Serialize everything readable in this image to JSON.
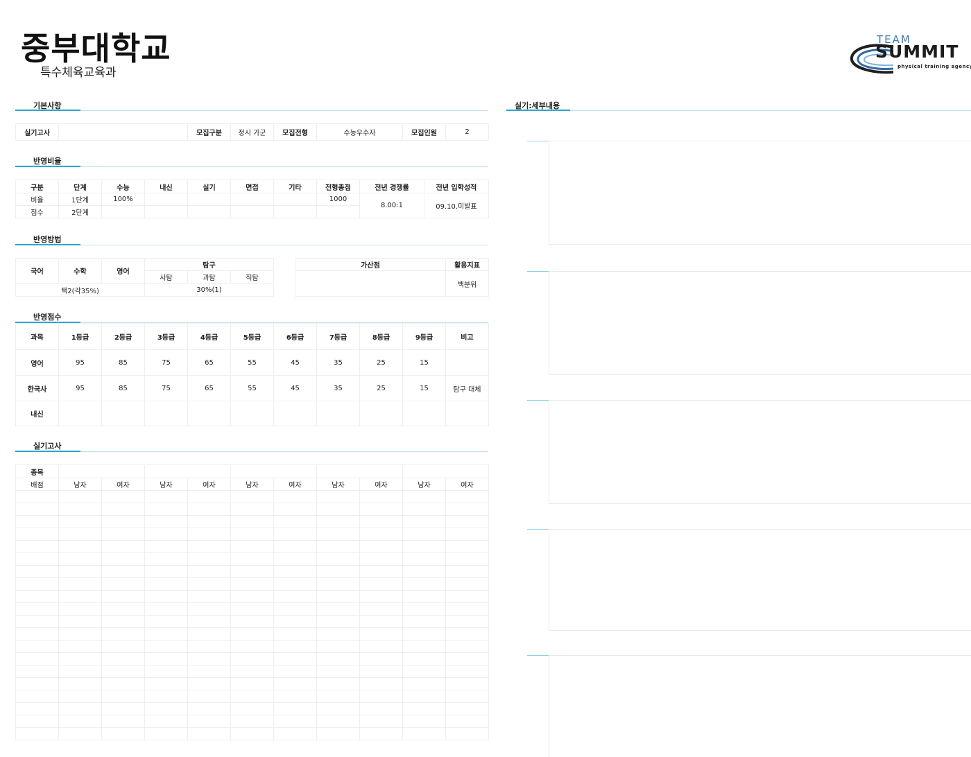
{
  "header": {
    "title": "중부대학교",
    "subtitle": "특수체육교육과"
  },
  "logo": {
    "team": "TEAM",
    "summit": "SUMMIT",
    "tagline": "physical training agency"
  },
  "sections": {
    "basic": "기본사항",
    "ratio": "반영비율",
    "method": "반영방법",
    "score": "반영점수",
    "practical": "실기고사",
    "detail": "실기:세부내용"
  },
  "basic_info": {
    "exam_label": "실기고사",
    "exam_value": "",
    "type_label": "모집구분",
    "type_value": "정시 가군",
    "process_label": "모집전형",
    "process_value": "수능우수자",
    "quota_label": "모집인원",
    "quota_value": "2"
  },
  "ratio_table": {
    "headers": [
      "구분",
      "단계",
      "수능",
      "내신",
      "실기",
      "면접",
      "기타",
      "전형총점",
      "전년 경쟁률",
      "전년 입학성적"
    ],
    "row1": [
      "비율",
      "1단계",
      "100%",
      "",
      "",
      "",
      "",
      "1000"
    ],
    "row2": [
      "점수",
      "2단계",
      "",
      "",
      "",
      "",
      "",
      ""
    ],
    "competition": "8.00:1",
    "admission": "09.10.미발표"
  },
  "method_table": {
    "korean": "국어",
    "math": "수학",
    "english": "영어",
    "inquiry": "탐구",
    "social": "사탐",
    "science": "과탐",
    "vocational": "직탐",
    "core_value": "택2(각35%)",
    "inquiry_value": "30%(1)",
    "bonus_label": "가산점",
    "bonus_value": "",
    "index_label": "활용지표",
    "index_value": "백분위"
  },
  "score_table": {
    "headers": [
      "과목",
      "1등급",
      "2등급",
      "3등급",
      "4등급",
      "5등급",
      "6등급",
      "7등급",
      "8등급",
      "9등급",
      "비고"
    ],
    "rows": [
      {
        "subject": "영어",
        "values": [
          "95",
          "85",
          "75",
          "65",
          "55",
          "45",
          "35",
          "25",
          "15"
        ],
        "note": ""
      },
      {
        "subject": "한국사",
        "values": [
          "95",
          "85",
          "75",
          "65",
          "55",
          "45",
          "35",
          "25",
          "15"
        ],
        "note": "탐구 대체"
      },
      {
        "subject": "내신",
        "values": [
          "",
          "",
          "",
          "",
          "",
          "",
          "",
          "",
          ""
        ],
        "note": ""
      }
    ]
  },
  "practical_table": {
    "event_label": "종목",
    "score_label": "배점",
    "genders": [
      "남자",
      "여자",
      "남자",
      "여자",
      "남자",
      "여자",
      "남자",
      "여자",
      "남자",
      "여자"
    ]
  }
}
